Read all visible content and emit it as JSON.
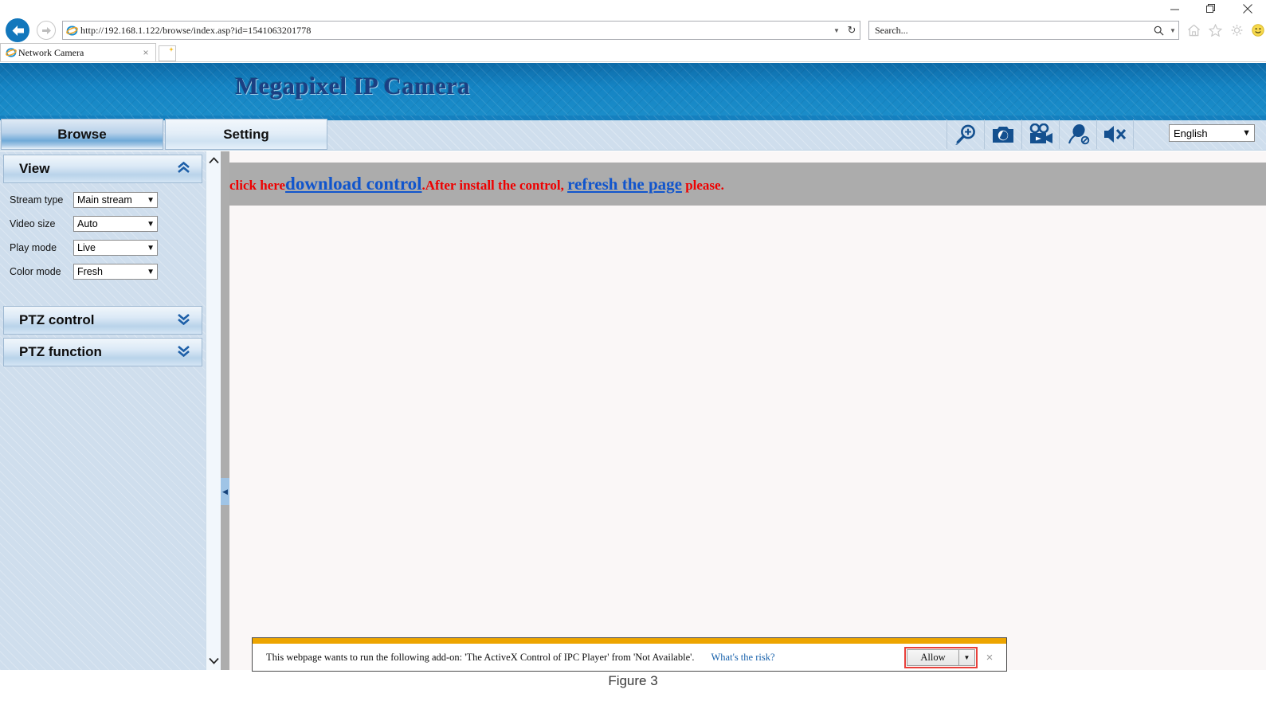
{
  "window": {
    "minimize_label": "–",
    "restore_label": "❐",
    "close_label": "✕"
  },
  "browser": {
    "url": "http://192.168.1.122/browse/index.asp?id=1541063201778",
    "url_dropdown_icon": "chevron-down-icon",
    "reload_icon": "refresh-icon",
    "back_icon": "back-arrow-icon",
    "forward_icon": "forward-arrow-icon",
    "search_placeholder": "Search...",
    "search_icon": "search-icon",
    "search_dropdown_icon": "chevron-down-icon",
    "toolbar_icons": [
      "home-icon",
      "favorites-star-icon",
      "gear-icon",
      "smiley-feedback-icon"
    ],
    "tab": {
      "title": "Network Camera",
      "favicon": "internet-explorer-icon",
      "close_label": "×"
    },
    "new_tab_label": ""
  },
  "app": {
    "banner_title": "Megapixel IP Camera",
    "tabs": [
      {
        "label": "Browse",
        "active": true
      },
      {
        "label": "Setting",
        "active": false
      }
    ],
    "toolbar_icons": [
      {
        "name": "zoom-in-icon"
      },
      {
        "name": "snapshot-camera-icon"
      },
      {
        "name": "record-video-icon"
      },
      {
        "name": "microphone-off-icon"
      },
      {
        "name": "speaker-mute-icon"
      }
    ],
    "language": {
      "value": "English",
      "arrow": "⌄"
    }
  },
  "sidebar": {
    "sections": [
      {
        "title": "View",
        "chevron": "«",
        "expanded": true,
        "fields": [
          {
            "label": "Stream type",
            "value": "Main stream"
          },
          {
            "label": "Video size",
            "value": "Auto"
          },
          {
            "label": "Play mode",
            "value": "Live"
          },
          {
            "label": "Color mode",
            "value": "Fresh"
          }
        ]
      },
      {
        "title": "PTZ control",
        "chevron": "»",
        "expanded": false
      },
      {
        "title": "PTZ function",
        "chevron": "»",
        "expanded": false
      }
    ],
    "scroll_up": "∧",
    "scroll_down": "∨",
    "collapse_handle": "◀"
  },
  "main": {
    "notice": {
      "part1": "click here",
      "link1": "download control",
      "part2": ".After install the control, ",
      "link2": "refresh the page",
      "part3": " please."
    }
  },
  "notification": {
    "message": "This webpage wants to run the following add-on: 'The ActiveX Control of IPC Player' from 'Not Available'.",
    "risk_link": "What's the risk?",
    "allow_label": "Allow",
    "dropdown_arrow": "▼",
    "close_label": "×"
  },
  "caption": "Figure 3",
  "colors": {
    "banner_blue": "#1484c4",
    "banner_title": "#1b3f82",
    "panel_blue": "#cfdeed",
    "notice_grey": "#acacac",
    "notice_red": "#ee0000",
    "notice_link": "#1155cc",
    "notif_gold": "#eda500",
    "highlight_red": "#e8403a"
  }
}
